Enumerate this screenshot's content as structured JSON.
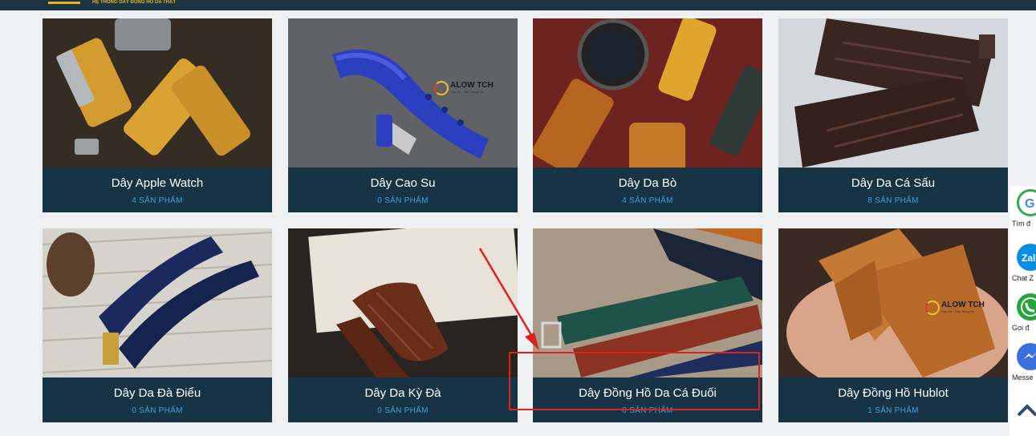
{
  "header": {
    "tagline": "HỆ THỐNG DÂY ĐỒNG HỒ DA THẬT"
  },
  "categories": [
    {
      "title": "Dây Apple Watch",
      "count": "4 SẢN PHẨM",
      "image": "apple-watch-strap-photo"
    },
    {
      "title": "Dây Cao Su",
      "count": "0 SẢN PHẨM",
      "image": "rubber-strap-photo"
    },
    {
      "title": "Dây Da Bò",
      "count": "4 SẢN PHẨM",
      "image": "cowhide-strap-photo"
    },
    {
      "title": "Dây Da Cá Sấu",
      "count": "8 SẢN PHẨM",
      "image": "crocodile-strap-photo"
    },
    {
      "title": "Dây Da Đà Điểu",
      "count": "0 SẢN PHẨM",
      "image": "ostrich-strap-photo"
    },
    {
      "title": "Dây Da Kỳ Đà",
      "count": "0 SẢN PHẨM",
      "image": "lizard-strap-photo"
    },
    {
      "title": "Dây Đồng Hồ Da Cá Đuối",
      "count": "0 SẢN PHẨM",
      "image": "stingray-strap-photo"
    },
    {
      "title": "Dây Đồng Hồ Hublot",
      "count": "1 SẢN PHẨM",
      "image": "hublot-strap-photo"
    }
  ],
  "brand_watermark": {
    "name": "ALOW TCH",
    "sub": "Dây Da - Dây Đồng Hồ"
  },
  "contact_bar": {
    "items": [
      {
        "label": "Tìm đ",
        "icon": "google-maps-icon",
        "color": "#34a853"
      },
      {
        "label": "Chat Z",
        "icon": "zalo-icon",
        "color": "#0a8de4"
      },
      {
        "label": "Gọi đ",
        "icon": "phone-icon",
        "color": "#26a53d"
      },
      {
        "label": "Messe",
        "icon": "messenger-icon",
        "color": "#3b6fe0"
      }
    ]
  },
  "colors": {
    "card_footer": "#173447",
    "count_text": "#3ea0d8",
    "highlight": "#e0201c",
    "header_bar": "#1c3444"
  }
}
